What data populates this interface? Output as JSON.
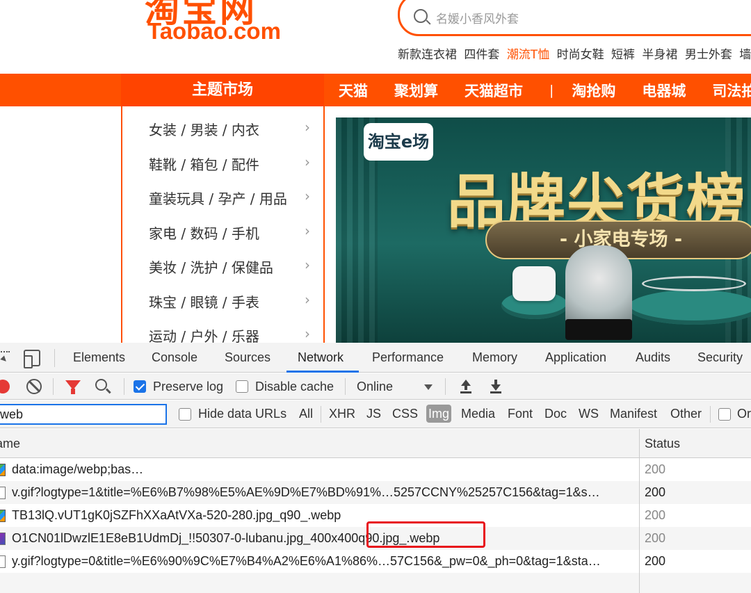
{
  "site": {
    "logo_cn": "淘宝网",
    "logo_en": "Taobao.com",
    "search_placeholder": "名媛小香风外套",
    "hotwords": [
      "新款连衣裙",
      "四件套",
      "潮流T恤",
      "时尚女鞋",
      "短裤",
      "半身裙",
      "男士外套",
      "墙"
    ],
    "hotword_highlight_index": 2,
    "nav_theme": "主题市场",
    "nav_links": [
      "天猫",
      "聚划算",
      "天猫超市",
      "|",
      "淘抢购",
      "电器城",
      "司法拍"
    ],
    "categories": [
      "女装 / 男装 / 内衣",
      "鞋靴 / 箱包 / 配件",
      "童装玩具 / 孕产 / 用品",
      "家电 / 数码 / 手机",
      "美妆 / 洗护 / 保健品",
      "珠宝 / 眼镜 / 手表",
      "运动 / 户外 / 乐器"
    ],
    "category_arrow": "›",
    "banner": {
      "logo": "淘宝e场",
      "title": "品牌尖货榜",
      "subtitle": "- 小家电专场 -"
    },
    "colors": {
      "brand": "#ff5000",
      "nav_theme_bg": "#ff4400"
    }
  },
  "devtools": {
    "tabs": [
      "Elements",
      "Console",
      "Sources",
      "Network",
      "Performance",
      "Memory",
      "Application",
      "Audits",
      "Security"
    ],
    "active_tab": "Network",
    "toolbar": {
      "preserve_log": "Preserve log",
      "preserve_log_checked": true,
      "disable_cache": "Disable cache",
      "disable_cache_checked": false,
      "throttling": "Online"
    },
    "filter": {
      "value": "web",
      "hide_data_urls": "Hide data URLs",
      "types": [
        "All",
        "XHR",
        "JS",
        "CSS",
        "Img",
        "Media",
        "Font",
        "Doc",
        "WS",
        "Manifest",
        "Other"
      ],
      "selected_type": "Img",
      "trailing_label": "Or"
    },
    "columns": {
      "name": "ame",
      "status": "Status"
    },
    "rows": [
      {
        "name": "data:image/webp;bas…",
        "status": "200",
        "icon": "image-file-icon"
      },
      {
        "name": "v.gif?logtype=1&title=%E6%B7%98%E5%AE%9D%E7%BD%91%…5257CCNY%25257C156&tag=1&s…",
        "status": "200",
        "icon": "gif-file-icon"
      },
      {
        "name": "TB13lQ.vUT1gK0jSZFhXXaAtVXa-520-280.jpg_q90_.webp",
        "status": "200",
        "icon": "image-file-icon"
      },
      {
        "name": "O1CN01lDwzlE1E8eB1UdmDj_!!50307-0-lubanu.jpg_400x400q90.jpg_.webp",
        "status": "200",
        "icon": "image-file-icon"
      },
      {
        "name": "y.gif?logtype=0&title=%E6%90%9C%E7%B4%A2%E6%A1%86%…57C156&_pw=0&_ph=0&tag=1&sta…",
        "status": "200",
        "icon": "gif-file-icon"
      }
    ],
    "colors": {
      "accent": "#1a73e8",
      "record": "#e53935",
      "annotation": "#e8101a"
    }
  }
}
